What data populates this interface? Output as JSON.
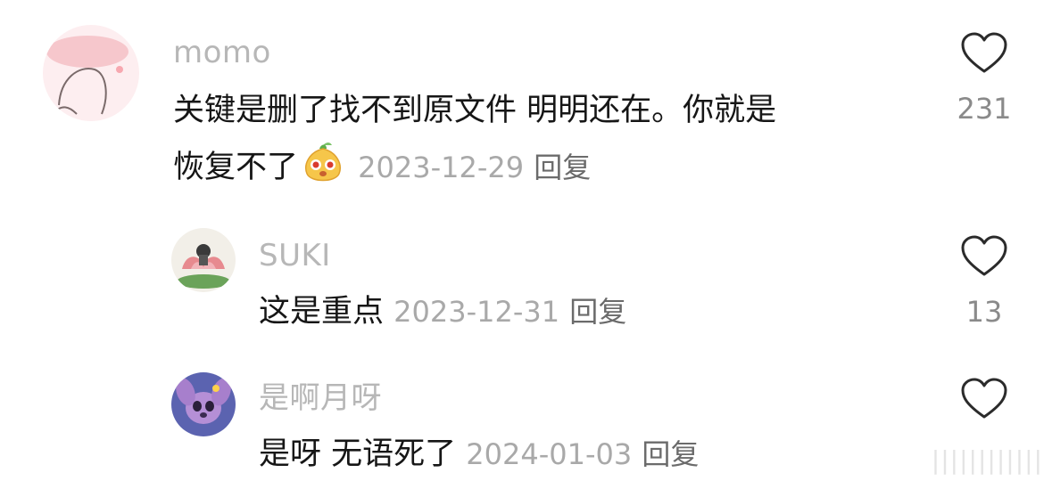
{
  "comments": [
    {
      "username": "momo",
      "line1": "关键是删了找不到原文件 明明还在。你就是",
      "line2": "恢复不了",
      "emoji": "chestnut-smile-emoji",
      "date": "2023-12-29",
      "reply_label": "回复",
      "likes": "231"
    },
    {
      "username": "SUKI",
      "text": "这是重点",
      "date": "2023-12-31",
      "reply_label": "回复",
      "likes": "13"
    },
    {
      "username": "是啊月呀",
      "text": "是呀 无语死了",
      "date": "2024-01-03",
      "reply_label": "回复",
      "likes": ""
    }
  ],
  "icons": {
    "like": "heart-outline-icon"
  },
  "colors": {
    "username": "#b7b7b7",
    "meta": "#a9a9a9",
    "text": "#161616"
  },
  "watermark": "||||||||||||"
}
